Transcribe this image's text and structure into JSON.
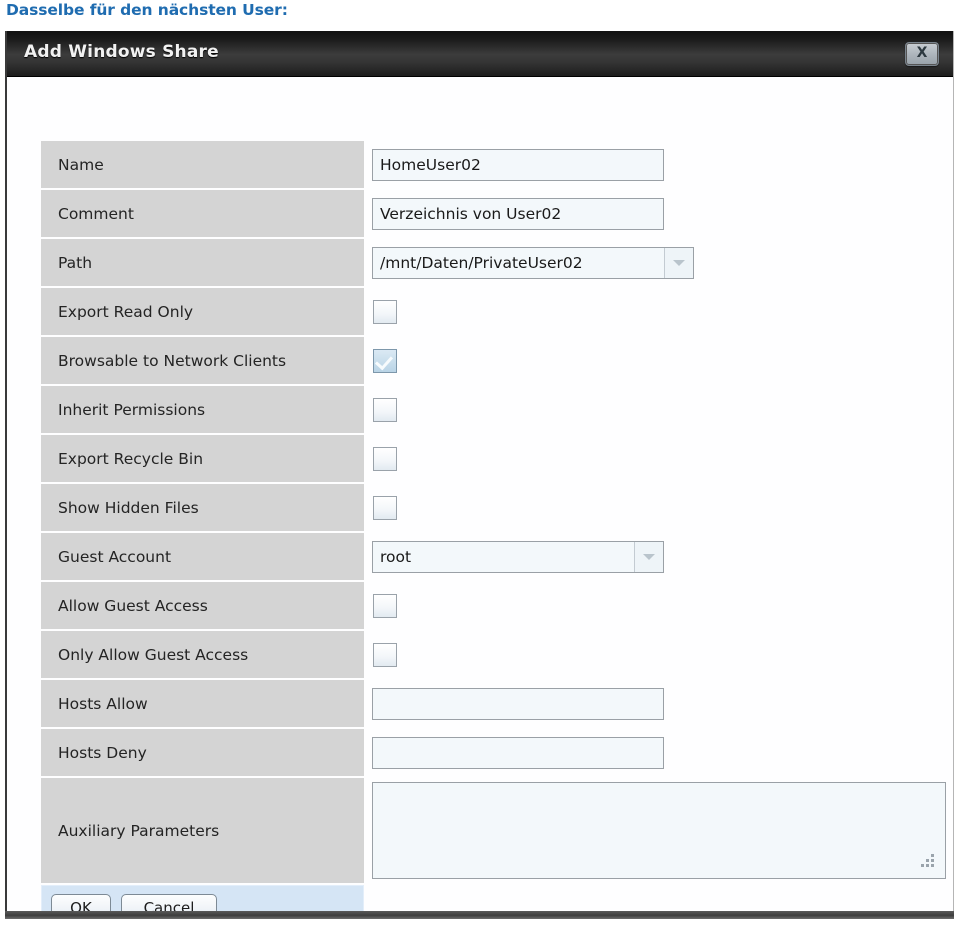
{
  "page": {
    "heading": "Dasselbe für den nächsten User:"
  },
  "dialog": {
    "title": "Add Windows Share",
    "close_label": "X",
    "close_icon": "close-icon",
    "rows": [
      {
        "label": "Name",
        "type": "text",
        "value": "HomeUser02"
      },
      {
        "label": "Comment",
        "type": "text",
        "value": "Verzeichnis von User02"
      },
      {
        "label": "Path",
        "type": "combo",
        "value": "/mnt/Daten/PrivateUser02"
      },
      {
        "label": "Export Read Only",
        "type": "checkbox",
        "checked": false
      },
      {
        "label": "Browsable to Network Clients",
        "type": "checkbox",
        "checked": true
      },
      {
        "label": "Inherit Permissions",
        "type": "checkbox",
        "checked": false
      },
      {
        "label": "Export Recycle Bin",
        "type": "checkbox",
        "checked": false
      },
      {
        "label": "Show Hidden Files",
        "type": "checkbox",
        "checked": false
      },
      {
        "label": "Guest Account",
        "type": "combo",
        "value": "root"
      },
      {
        "label": "Allow Guest Access",
        "type": "checkbox",
        "checked": false
      },
      {
        "label": "Only Allow Guest Access",
        "type": "checkbox",
        "checked": false
      },
      {
        "label": "Hosts Allow",
        "type": "text",
        "value": ""
      },
      {
        "label": "Hosts Deny",
        "type": "text",
        "value": ""
      },
      {
        "label": "Auxiliary Parameters",
        "type": "textarea",
        "value": ""
      }
    ],
    "footer": {
      "ok_label": "OK",
      "cancel_label": "Cancel"
    }
  },
  "colors": {
    "heading_blue": "#1f6cb0",
    "label_cell": "#d4d4d4",
    "input_bg": "#f3f8fb",
    "footer_bg": "#d5e5f5",
    "titlebar_dark": "#1a1a1a",
    "checkbox_checked": "#b9d4e6"
  }
}
